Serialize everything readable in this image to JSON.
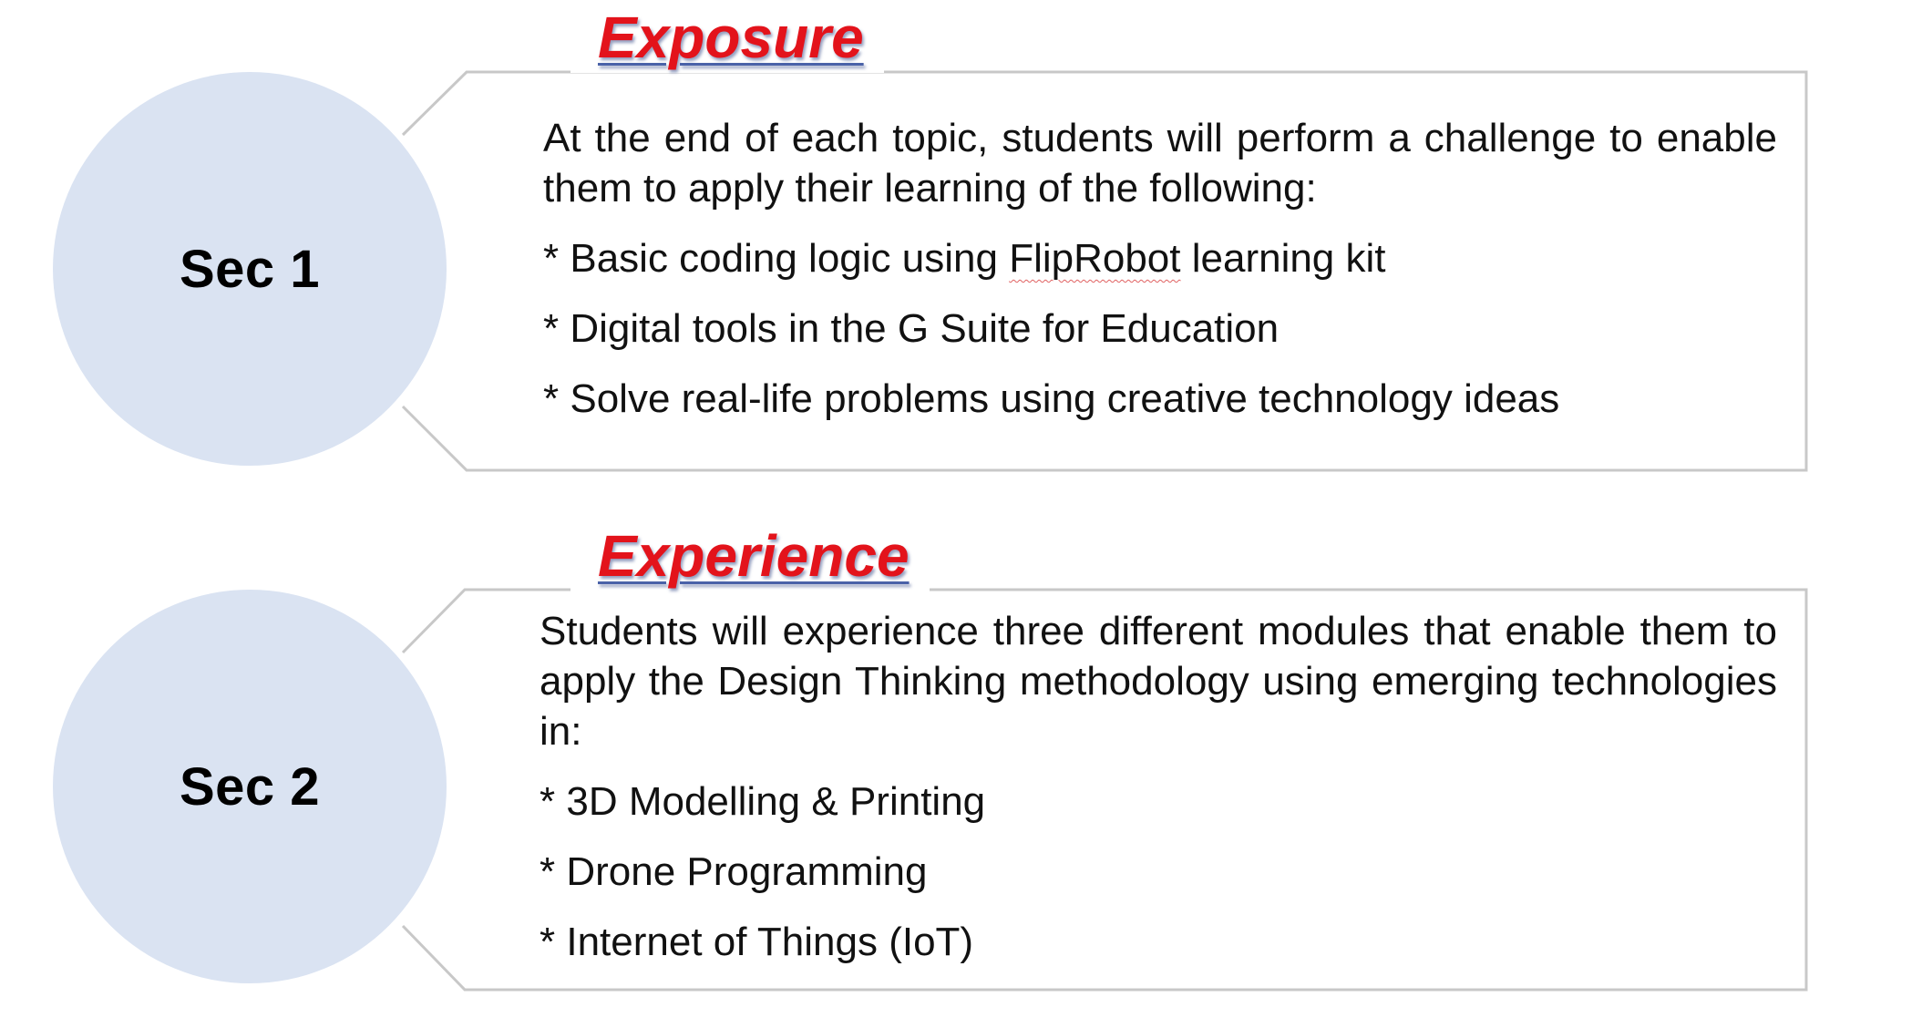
{
  "sections": [
    {
      "circle_label": "Sec 1",
      "heading": "Exposure",
      "intro": "At the end of each topic, students will perform a challenge to enable them to apply their learning of the following:",
      "bullets": [
        {
          "prefix": "* Basic coding logic using ",
          "flagged_word": "FlipRobot",
          "suffix": " learning kit"
        },
        {
          "text": "* Digital tools in the G Suite for Education"
        },
        {
          "text": "* Solve real-life problems using creative technology ideas"
        }
      ]
    },
    {
      "circle_label": "Sec 2",
      "heading": "Experience",
      "intro": "Students will experience three different modules that enable them to apply the Design Thinking methodology using emerging technologies in:",
      "bullets": [
        {
          "text": "* 3D Modelling & Printing"
        },
        {
          "text": "* Drone Programming"
        },
        {
          "text": "* Internet of Things (IoT)"
        }
      ]
    }
  ],
  "colors": {
    "circle_fill": "#dae3f2",
    "heading_text": "#e3131b",
    "frame_stroke": "#c8c8c8",
    "body_text": "#111111"
  }
}
